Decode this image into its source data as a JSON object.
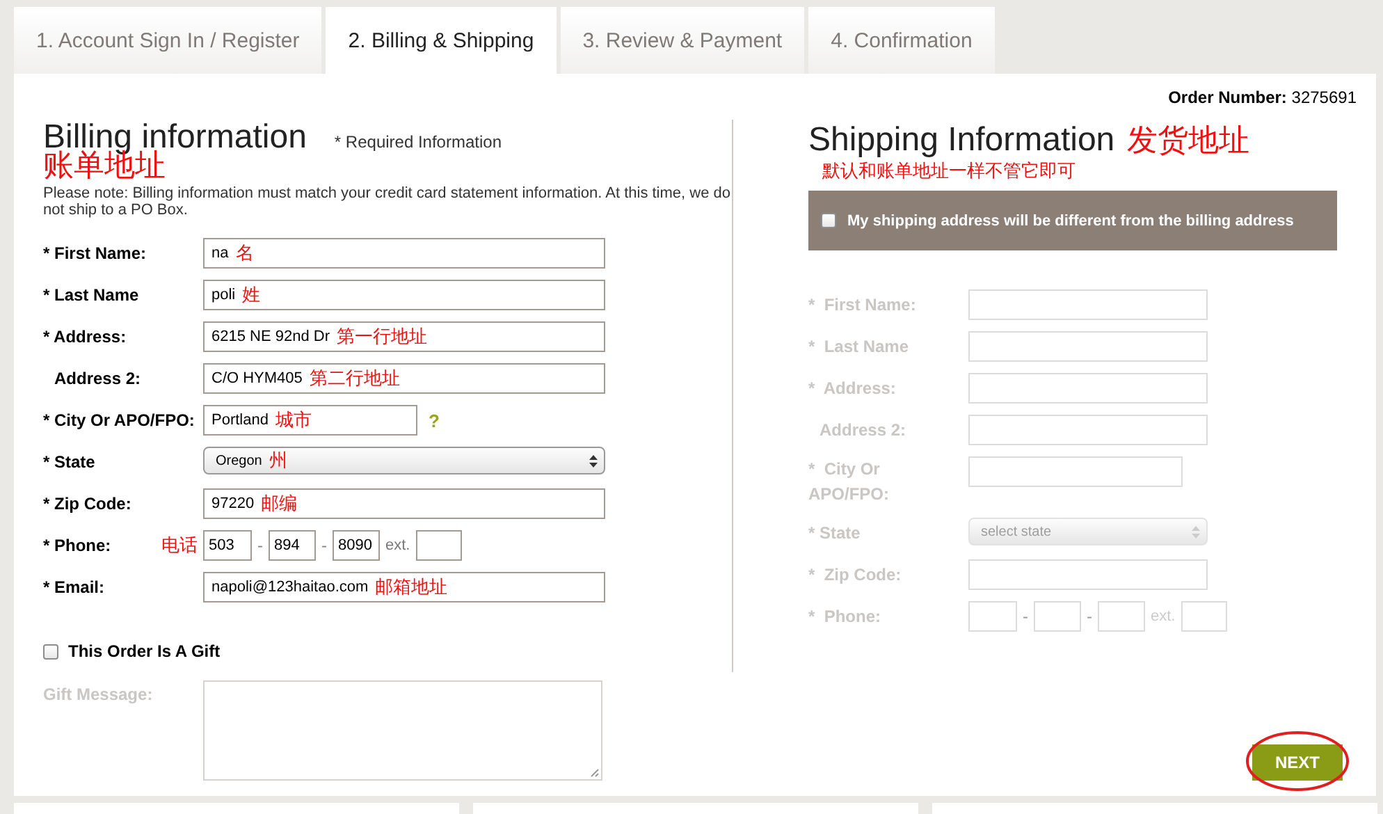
{
  "tabs": [
    {
      "label": "1. Account Sign In / Register",
      "selected": false
    },
    {
      "label": "2. Billing & Shipping",
      "selected": true
    },
    {
      "label": "3. Review & Payment",
      "selected": false
    },
    {
      "label": "4. Confirmation",
      "selected": false
    }
  ],
  "order_number": {
    "label": "Order Number:",
    "value": "3275691"
  },
  "billing": {
    "title": "Billing information",
    "annotation": "账单地址",
    "required_note": "* Required Information",
    "note": "Please note: Billing information must match your credit card statement information. At this time, we do not ship to a PO Box.",
    "fields": [
      {
        "kind": "text",
        "label": "* First Name:",
        "required": true,
        "value": "na",
        "annotation": "名"
      },
      {
        "kind": "text",
        "label": "* Last Name",
        "required": true,
        "value": "poli",
        "annotation": "姓"
      },
      {
        "kind": "text",
        "label": "* Address:",
        "required": true,
        "value": "6215 NE 92nd Dr",
        "annotation": "第一行地址"
      },
      {
        "kind": "text",
        "label": "Address 2:",
        "required": false,
        "value": "C/O HYM405",
        "annotation": "第二行地址"
      },
      {
        "kind": "short",
        "label": "* City Or APO/FPO:",
        "required": true,
        "value": "Portland",
        "annotation": "城市",
        "help": "?"
      },
      {
        "kind": "select",
        "label": "* State",
        "required": true,
        "value": "Oregon",
        "annotation": "州"
      },
      {
        "kind": "text",
        "label": "* Zip Code:",
        "required": true,
        "value": "97220",
        "annotation": "邮编"
      },
      {
        "kind": "phone",
        "label": "* Phone:",
        "required": true,
        "annotation": "电话",
        "parts": [
          "503",
          "894",
          "8090"
        ],
        "separators": [
          "-",
          "-"
        ],
        "ext_label": "ext."
      },
      {
        "kind": "text",
        "label": "* Email:",
        "required": true,
        "value": "napoli@123haitao.com",
        "annotation": "邮箱地址"
      }
    ],
    "gift": {
      "label": "This Order Is A Gift",
      "checked": false
    }
  },
  "shipping": {
    "title": "Shipping Information",
    "annotation": "发货地址",
    "sub_annotation": "默认和账单地址一样不管它即可",
    "different_address": {
      "label": "My shipping address will be different from the billing address",
      "checked": false
    },
    "disabled": true,
    "fields": [
      {
        "kind": "text",
        "label": "*  First Name:",
        "required": true
      },
      {
        "kind": "text",
        "label": "*  Last Name",
        "required": true
      },
      {
        "kind": "text",
        "label": "*  Address:",
        "required": true
      },
      {
        "kind": "text",
        "label": "Address 2:",
        "required": false
      },
      {
        "kind": "short",
        "label": "*  City Or APO/FPO:",
        "required": true
      },
      {
        "kind": "select",
        "label": "* State",
        "required": true,
        "placeholder": "select state"
      },
      {
        "kind": "text",
        "label": "*  Zip Code:",
        "required": true
      },
      {
        "kind": "phone",
        "label": "*  Phone:",
        "required": true,
        "separators": [
          "-",
          "-"
        ],
        "ext_label": "ext."
      }
    ]
  },
  "gift_message": {
    "label": "Gift Message:",
    "disabled": true
  },
  "next_button": {
    "label": "NEXT",
    "highlighted": true
  }
}
